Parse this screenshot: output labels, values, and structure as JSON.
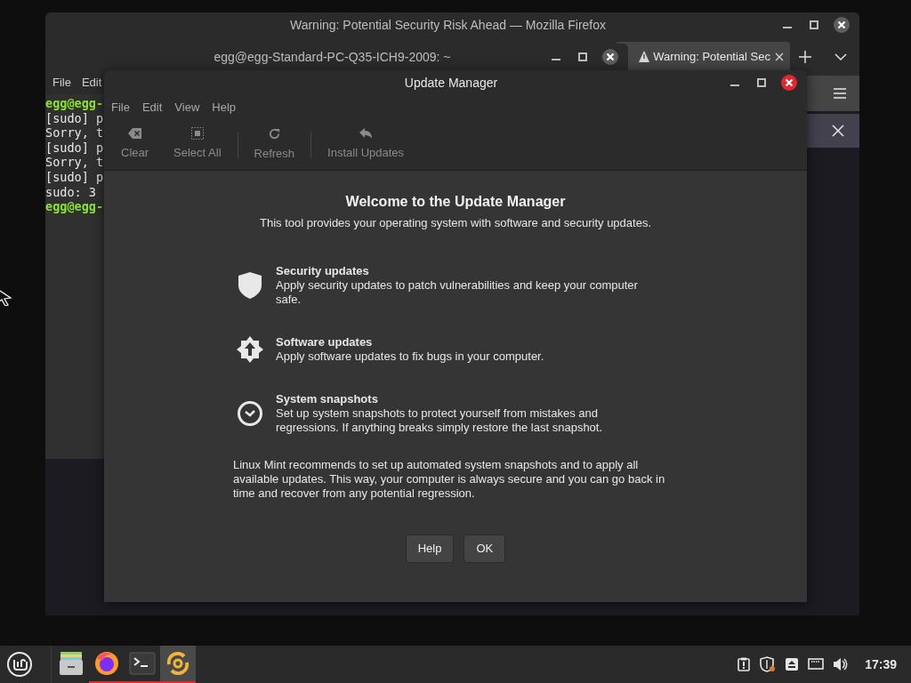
{
  "firefox": {
    "title": "Warning: Potential Security Risk Ahead — Mozilla Firefox",
    "tabs": [
      {
        "label": "Warning: Potential Sec",
        "selected": true
      }
    ]
  },
  "terminal": {
    "title": "egg@egg-Standard-PC-Q35-ICH9-2009: ~",
    "menu": [
      "File",
      "Edit"
    ],
    "lines": [
      {
        "kind": "prompt",
        "text": "egg@egg-"
      },
      {
        "kind": "output",
        "text": "[sudo] p"
      },
      {
        "kind": "output",
        "text": "Sorry, t"
      },
      {
        "kind": "output",
        "text": "[sudo] p"
      },
      {
        "kind": "output",
        "text": "Sorry, t"
      },
      {
        "kind": "output",
        "text": "[sudo] p"
      },
      {
        "kind": "output",
        "text": "sudo: 3"
      },
      {
        "kind": "prompt",
        "text": "egg@egg-"
      }
    ]
  },
  "update_manager": {
    "title": "Update Manager",
    "menu": [
      "File",
      "Edit",
      "View",
      "Help"
    ],
    "toolbar": [
      {
        "kind": "clear",
        "label": "Clear",
        "disabled": true
      },
      {
        "kind": "select_all",
        "label": "Select All",
        "disabled": true
      },
      {
        "kind": "refresh",
        "label": "Refresh",
        "disabled": true
      },
      {
        "kind": "install",
        "label": "Install Updates",
        "disabled": true
      }
    ],
    "heading": "Welcome to the Update Manager",
    "subtitle": "This tool provides your operating system with software and security updates.",
    "features": [
      {
        "kind": "security",
        "title": "Security updates",
        "description": "Apply security updates to patch vulnerabilities and keep your computer safe."
      },
      {
        "kind": "software",
        "title": "Software updates",
        "description": "Apply software updates to fix bugs in your computer."
      },
      {
        "kind": "snapshots",
        "title": "System snapshots",
        "description": "Set up system snapshots to protect yourself from mistakes and regressions. If anything breaks simply restore the last snapshot."
      }
    ],
    "recommendation": "Linux Mint recommends to set up automated system snapshots and to apply all available updates. This way, your computer is always secure and you can go back in time and recover from any potential regression.",
    "buttons": [
      "Help",
      "OK"
    ]
  },
  "taskbar": {
    "apps": [
      {
        "kind": "files",
        "running": false,
        "selected": false
      },
      {
        "kind": "firefox",
        "running": true,
        "selected": false
      },
      {
        "kind": "terminal",
        "running": true,
        "selected": false
      },
      {
        "kind": "update_manager",
        "running": true,
        "selected": true
      }
    ],
    "tray": [
      {
        "kind": "clipboard"
      },
      {
        "kind": "shield"
      },
      {
        "kind": "eject"
      },
      {
        "kind": "network"
      },
      {
        "kind": "volume"
      }
    ],
    "clock": "17:39"
  }
}
